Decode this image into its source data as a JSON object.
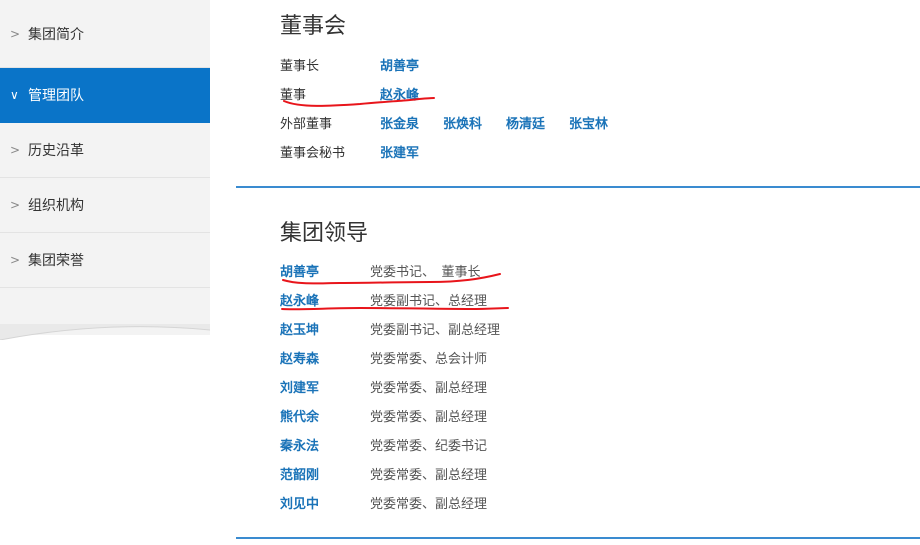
{
  "sidebar": {
    "items": [
      {
        "label": "集团简介",
        "active": false
      },
      {
        "label": "管理团队",
        "active": true
      },
      {
        "label": "历史沿革",
        "active": false
      },
      {
        "label": "组织机构",
        "active": false
      },
      {
        "label": "集团荣誉",
        "active": false
      }
    ]
  },
  "board": {
    "title": "董事会",
    "rows": [
      {
        "label": "董事长",
        "names": [
          "胡善亭"
        ]
      },
      {
        "label": "董事",
        "names": [
          "赵永峰"
        ]
      },
      {
        "label": "外部董事",
        "names": [
          "张金泉",
          "张焕科",
          "杨清廷",
          "张宝林"
        ]
      },
      {
        "label": "董事会秘书",
        "names": [
          "张建军"
        ]
      }
    ]
  },
  "leaders": {
    "title": "集团领导",
    "rows": [
      {
        "name": "胡善亭",
        "title": "党委书记、　董事长"
      },
      {
        "name": "赵永峰",
        "title": "党委副书记、总经理"
      },
      {
        "name": "赵玉坤",
        "title": "党委副书记、副总经理"
      },
      {
        "name": "赵寿森",
        "title": "党委常委、总会计师"
      },
      {
        "name": "刘建军",
        "title": "党委常委、副总经理"
      },
      {
        "name": "熊代余",
        "title": "党委常委、副总经理"
      },
      {
        "name": "秦永法",
        "title": "党委常委、纪委书记"
      },
      {
        "name": "范韶刚",
        "title": "党委常委、副总经理"
      },
      {
        "name": "刘见中",
        "title": "党委常委、副总经理"
      }
    ]
  },
  "colors": {
    "accent": "#0a74c8",
    "link": "#1a73b8",
    "annotation": "#e8151b"
  }
}
